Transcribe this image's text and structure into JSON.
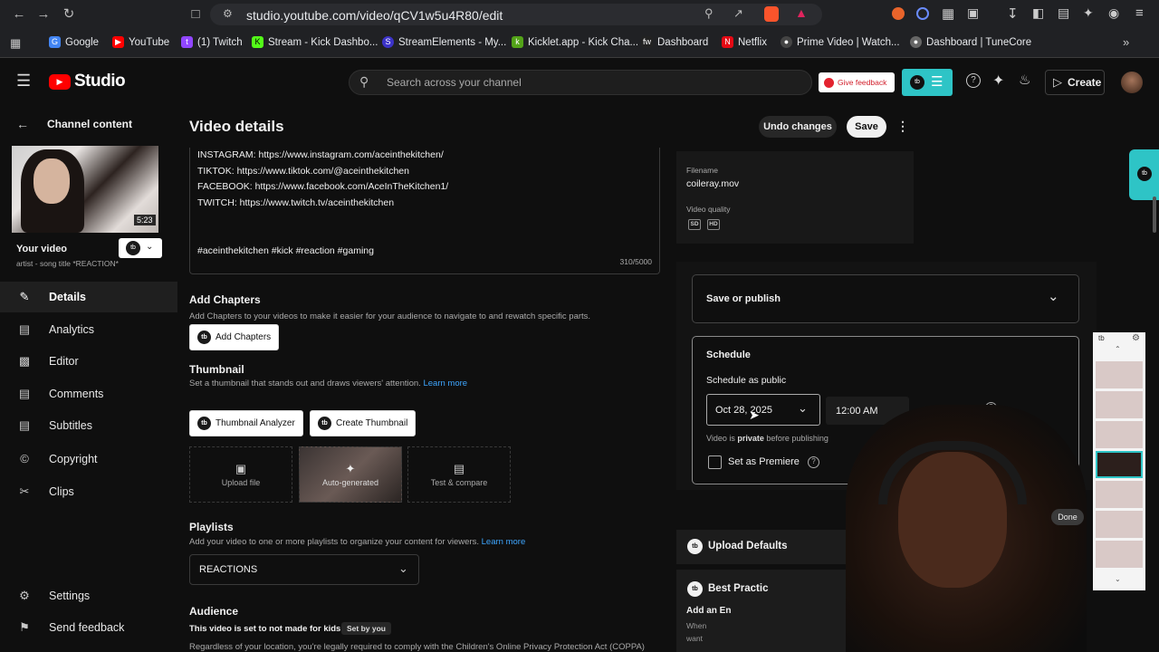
{
  "browser": {
    "url": "studio.youtube.com/video/qCV1w5u4R80/edit",
    "bookmarks": [
      {
        "label": "Google",
        "icon": "google-icon",
        "color": "#4285f4"
      },
      {
        "label": "YouTube",
        "icon": "youtube-icon",
        "color": "#ff0000"
      },
      {
        "label": "(1) Twitch",
        "icon": "twitch-icon",
        "color": "#9146ff"
      },
      {
        "label": "Stream - Kick Dashbo...",
        "icon": "kick-icon",
        "color": "#53fc18"
      },
      {
        "label": "StreamElements - My...",
        "icon": "streamelements-icon",
        "color": "#3c33c8"
      },
      {
        "label": "Kicklet.app - Kick Cha...",
        "icon": "kicklet-icon",
        "color": "#53a318"
      },
      {
        "label": "Dashboard",
        "icon": "fw-icon",
        "color": "#222222"
      },
      {
        "label": "Netflix",
        "icon": "netflix-icon",
        "color": "#e50914"
      },
      {
        "label": "Prime Video | Watch...",
        "icon": "prime-icon",
        "color": "#444444"
      },
      {
        "label": "Dashboard | TuneCore",
        "icon": "tunecore-icon",
        "color": "#666666"
      }
    ]
  },
  "header": {
    "logo_text": "Studio",
    "search_placeholder": "Search across your channel",
    "give_feedback": "Give feedback",
    "create_label": "Create"
  },
  "sidebar": {
    "back_label": "Channel content",
    "duration": "5:23",
    "your_video": "Your video",
    "video_subtitle": "artist - song title *REACTION*",
    "items": [
      {
        "label": "Details",
        "icon": "pencil-icon"
      },
      {
        "label": "Analytics",
        "icon": "analytics-icon"
      },
      {
        "label": "Editor",
        "icon": "editor-icon"
      },
      {
        "label": "Comments",
        "icon": "comments-icon"
      },
      {
        "label": "Subtitles",
        "icon": "subtitles-icon"
      },
      {
        "label": "Copyright",
        "icon": "copyright-icon"
      },
      {
        "label": "Clips",
        "icon": "clips-icon"
      }
    ],
    "settings": "Settings",
    "send_feedback": "Send feedback"
  },
  "page": {
    "title": "Video details",
    "undo": "Undo changes",
    "save": "Save"
  },
  "description": {
    "lines": [
      "INSTAGRAM: https://www.instagram.com/aceinthekitchen/",
      "TIKTOK: https://www.tiktok.com/@aceinthekitchen",
      "FACEBOOK: https://www.facebook.com/AceInTheKitchen1/",
      "TWITCH: https://www.twitch.tv/aceinthekitchen"
    ],
    "hashtags": "#aceinthekitchen #kick #reaction #gaming",
    "counter": "310/5000"
  },
  "chapters": {
    "title": "Add Chapters",
    "subtitle": "Add Chapters to your videos to make it easier for your audience to navigate to and rewatch specific parts.",
    "button": "Add Chapters"
  },
  "thumbnail": {
    "title": "Thumbnail",
    "subtitle": "Set a thumbnail that stands out and draws viewers' attention.",
    "learn_more": "Learn more",
    "analyzer": "Thumbnail Analyzer",
    "create": "Create Thumbnail",
    "upload": "Upload file",
    "auto": "Auto-generated",
    "test": "Test & compare"
  },
  "playlists": {
    "title": "Playlists",
    "subtitle": "Add your video to one or more playlists to organize your content for viewers.",
    "learn_more": "Learn more",
    "selected": "REACTIONS"
  },
  "audience": {
    "title": "Audience",
    "status": "This video is set to not made for kids",
    "set_by": "Set by you",
    "legal": "Regardless of your location, you're legally required to comply with the Children's Online Privacy Protection Act (COPPA)"
  },
  "file_info": {
    "filename_label": "Filename",
    "filename": "coileray.mov",
    "quality_label": "Video quality",
    "qualities": [
      "SD",
      "HD"
    ]
  },
  "publish": {
    "save_or_publish": "Save or publish",
    "schedule": "Schedule",
    "schedule_as": "Schedule as public",
    "date": "Oct 28, 2025",
    "time": "12:00 AM",
    "private_note_1": "Video is ",
    "private_note_bold": "private",
    "private_note_2": " before publishing",
    "premiere": "Set as Premiere",
    "done": "Done"
  },
  "extension": {
    "upload_defaults": "Upload Defaults",
    "best_practices": "Best Practic",
    "add_an": "Add an En",
    "when": "When",
    "want": "want"
  },
  "colors": {
    "accent_teal": "#2ec4c6",
    "youtube_red": "#ff0000",
    "link_blue": "#3ea6ff"
  }
}
